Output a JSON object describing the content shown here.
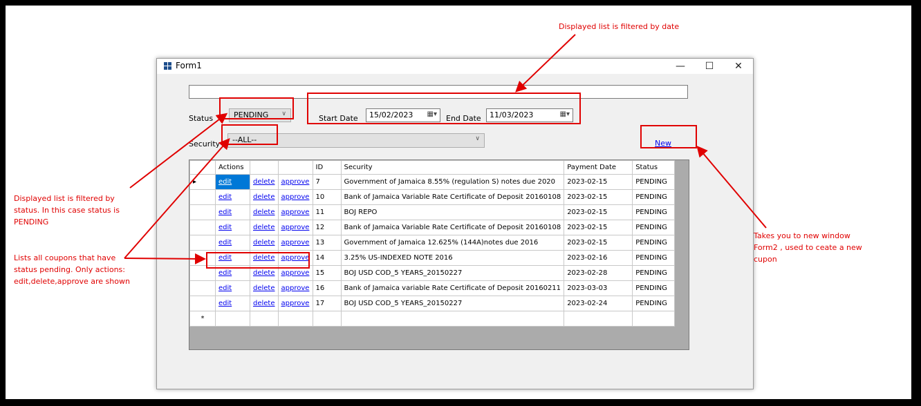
{
  "window": {
    "title": "Form1",
    "minimize_glyph": "—",
    "maximize_glyph": "☐",
    "close_glyph": "✕"
  },
  "filters": {
    "status_label": "Status",
    "status_value": "PENDING",
    "start_date_label": "Start Date",
    "start_date_value": "15/02/2023",
    "end_date_label": "End Date",
    "end_date_value": "11/03/2023",
    "security_label": "Security",
    "security_value": "--ALL--",
    "new_link": "New"
  },
  "grid": {
    "headers": [
      "Actions",
      "",
      "",
      "ID",
      "Security",
      "Payment Date",
      "Status"
    ],
    "edit_label": "edit",
    "delete_label": "delete",
    "approve_label": "approve",
    "new_row_marker": "*",
    "rows": [
      {
        "id": "7",
        "security": "Government of Jamaica 8.55% (regulation S) notes due 2020",
        "date": "2023-02-15",
        "status": "PENDING"
      },
      {
        "id": "10",
        "security": "Bank of Jamaica Variable Rate Certificate of Deposit 20160108",
        "date": "2023-02-15",
        "status": "PENDING"
      },
      {
        "id": "11",
        "security": "BOJ REPO",
        "date": "2023-02-15",
        "status": "PENDING"
      },
      {
        "id": "12",
        "security": "Bank of Jamaica Variable Rate Certificate of Deposit 20160108",
        "date": "2023-02-15",
        "status": "PENDING"
      },
      {
        "id": "13",
        "security": "Government of Jamaica 12.625% (144A)notes due 2016",
        "date": "2023-02-15",
        "status": "PENDING"
      },
      {
        "id": "14",
        "security": "3.25% US-INDEXED NOTE 2016",
        "date": "2023-02-16",
        "status": "PENDING"
      },
      {
        "id": "15",
        "security": "BOJ USD COD_5 YEARS_20150227",
        "date": "2023-02-28",
        "status": "PENDING"
      },
      {
        "id": "16",
        "security": "Bank of Jamaica variable Rate Certificate of Deposit 20160211",
        "date": "2023-03-03",
        "status": "PENDING"
      },
      {
        "id": "17",
        "security": "BOJ USD COD_5 YEARS_20150227",
        "date": "2023-02-24",
        "status": "PENDING"
      }
    ]
  },
  "annotations": {
    "date_note": "Displayed list is filtered by date",
    "status_note": [
      "Displayed list is filtered by",
      "status. In this case status is",
      "PENDING"
    ],
    "actions_note": [
      "Lists all coupons that have",
      "status pending. Only actions:",
      "edit,delete,approve are shown"
    ],
    "new_note": [
      "Takes you to new window",
      "Form2 , used to ceate a new",
      "cupon"
    ],
    "color": "#e00000"
  }
}
